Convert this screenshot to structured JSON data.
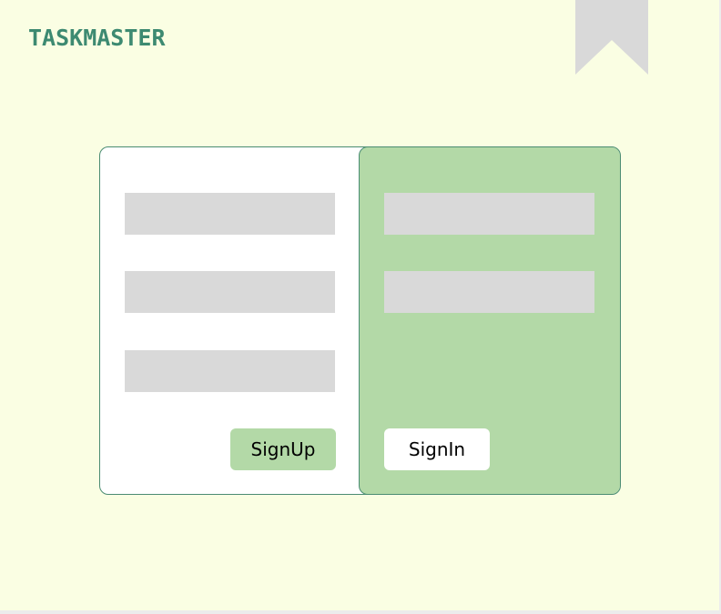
{
  "header": {
    "logo_text": "TASKMASTER"
  },
  "icons": {
    "bookmark": "bookmark-icon"
  },
  "colors": {
    "background": "#fafee3",
    "brand": "#3d8a71",
    "accent_green": "#b3d9a7",
    "field_gray": "#d9d9d9",
    "border": "#4a8c72"
  },
  "signup_panel": {
    "fields": [
      {
        "value": "",
        "placeholder": ""
      },
      {
        "value": "",
        "placeholder": ""
      },
      {
        "value": "",
        "placeholder": ""
      }
    ],
    "button_label": "SignUp"
  },
  "signin_panel": {
    "fields": [
      {
        "value": "",
        "placeholder": ""
      },
      {
        "value": "",
        "placeholder": ""
      }
    ],
    "button_label": "SignIn"
  }
}
